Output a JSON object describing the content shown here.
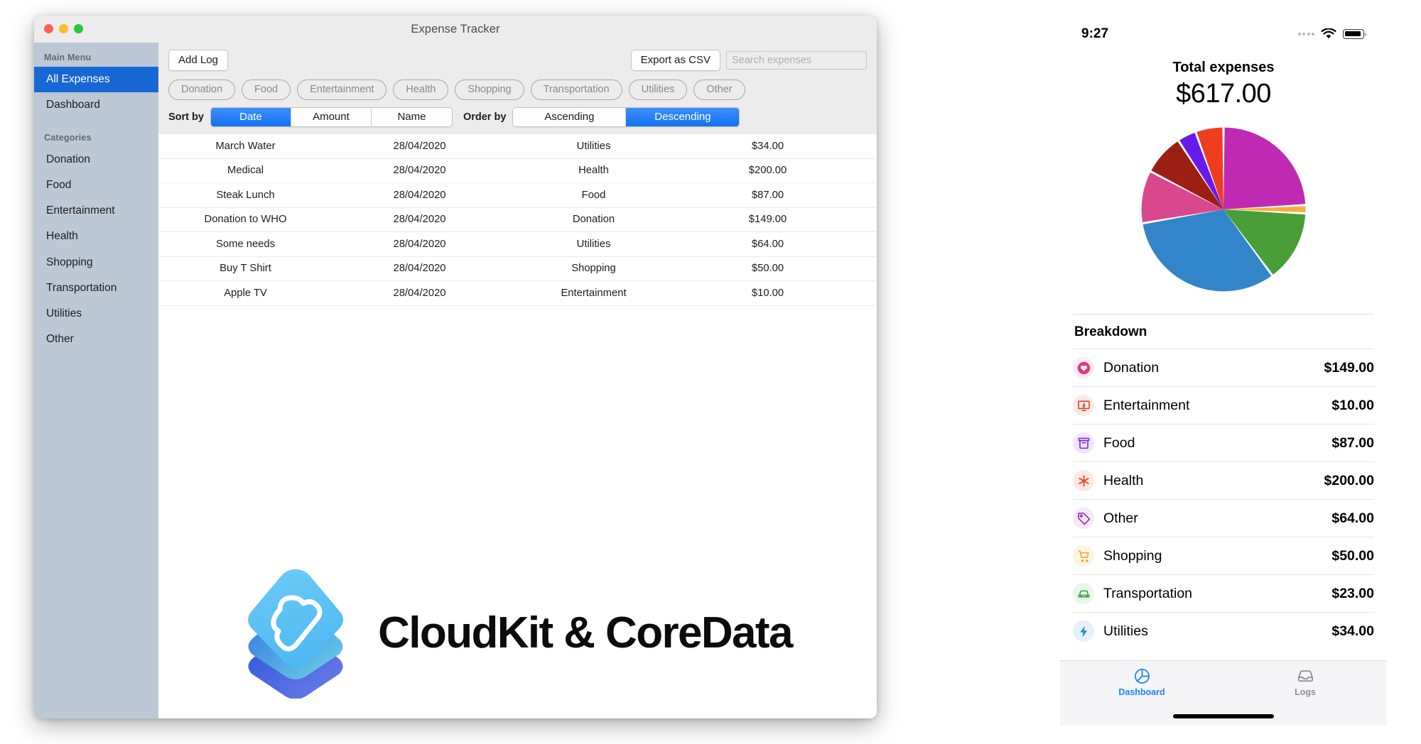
{
  "window": {
    "title": "Expense Tracker",
    "traffic_lights": [
      "close",
      "minimize",
      "zoom"
    ]
  },
  "sidebar": {
    "main_menu_header": "Main Menu",
    "main_items": [
      {
        "label": "All Expenses",
        "selected": true
      },
      {
        "label": "Dashboard",
        "selected": false
      }
    ],
    "categories_header": "Categories",
    "categories": [
      {
        "label": "Donation"
      },
      {
        "label": "Food"
      },
      {
        "label": "Entertainment"
      },
      {
        "label": "Health"
      },
      {
        "label": "Shopping"
      },
      {
        "label": "Transportation"
      },
      {
        "label": "Utilities"
      },
      {
        "label": "Other"
      }
    ]
  },
  "toolbar": {
    "add_log_label": "Add Log",
    "export_label": "Export as CSV",
    "search_placeholder": "Search expenses",
    "search_value": ""
  },
  "filter_chips": [
    "Donation",
    "Food",
    "Entertainment",
    "Health",
    "Shopping",
    "Transportation",
    "Utilities",
    "Other"
  ],
  "sort": {
    "sort_by_label": "Sort by",
    "sort_options": [
      {
        "label": "Date",
        "active": true
      },
      {
        "label": "Amount",
        "active": false
      },
      {
        "label": "Name",
        "active": false
      }
    ],
    "order_by_label": "Order by",
    "order_options": [
      {
        "label": "Ascending",
        "active": false
      },
      {
        "label": "Descending",
        "active": true
      }
    ]
  },
  "table": {
    "rows": [
      {
        "name": "March Water",
        "date": "28/04/2020",
        "category": "Utilities",
        "amount": "$34.00"
      },
      {
        "name": "Medical",
        "date": "28/04/2020",
        "category": "Health",
        "amount": "$200.00"
      },
      {
        "name": "Steak Lunch",
        "date": "28/04/2020",
        "category": "Food",
        "amount": "$87.00"
      },
      {
        "name": "Donation to WHO",
        "date": "28/04/2020",
        "category": "Donation",
        "amount": "$149.00"
      },
      {
        "name": "Some needs",
        "date": "28/04/2020",
        "category": "Utilities",
        "amount": "$64.00"
      },
      {
        "name": "Buy T Shirt",
        "date": "28/04/2020",
        "category": "Shopping",
        "amount": "$50.00"
      },
      {
        "name": "Apple TV",
        "date": "28/04/2020",
        "category": "Entertainment",
        "amount": "$10.00"
      }
    ]
  },
  "banner": {
    "title": "CloudKit & CoreData",
    "logo_icon": "cloudkit-logo"
  },
  "phone": {
    "status": {
      "time": "9:27",
      "wifi_icon": "wifi-icon",
      "battery_icon": "battery-icon"
    },
    "total_label": "Total expenses",
    "total_amount": "$617.00",
    "breakdown_title": "Breakdown",
    "breakdown": [
      {
        "label": "Donation",
        "amount": "$149.00",
        "icon": "heart-icon",
        "color": "#e4357f",
        "bg": "#fdeaf2"
      },
      {
        "label": "Entertainment",
        "amount": "$10.00",
        "icon": "tv-icon",
        "color": "#d8452b",
        "bg": "#fbe9e6"
      },
      {
        "label": "Food",
        "amount": "$87.00",
        "icon": "basket-icon",
        "color": "#7b20f0",
        "bg": "#f0e7fd"
      },
      {
        "label": "Health",
        "amount": "$200.00",
        "icon": "medical-icon",
        "color": "#f04a25",
        "bg": "#fdeae4"
      },
      {
        "label": "Other",
        "amount": "$64.00",
        "icon": "tag-icon",
        "color": "#8e2aa8",
        "bg": "#f6e9fb"
      },
      {
        "label": "Shopping",
        "amount": "$50.00",
        "icon": "cart-icon",
        "color": "#f0a82a",
        "bg": "#fdf5e4"
      },
      {
        "label": "Transportation",
        "amount": "$23.00",
        "icon": "car-icon",
        "color": "#3aa53a",
        "bg": "#e9f7ea"
      },
      {
        "label": "Utilities",
        "amount": "$34.00",
        "icon": "bolt-icon",
        "color": "#2b86e0",
        "bg": "#e7f1fc"
      }
    ],
    "tabs": [
      {
        "label": "Dashboard",
        "icon": "pie-chart-icon",
        "active": true
      },
      {
        "label": "Logs",
        "icon": "tray-icon",
        "active": false
      }
    ]
  },
  "chart_data": {
    "type": "pie",
    "title": "Total expenses",
    "labels": [
      "Donation",
      "Entertainment",
      "Food",
      "Health",
      "Other",
      "Shopping",
      "Transportation",
      "Utilities"
    ],
    "values": [
      149,
      10,
      87,
      200,
      64,
      50,
      23,
      34
    ],
    "total": 617,
    "colors": [
      "#c02ab2",
      "#efb03c",
      "#4a9e37",
      "#3185c8",
      "#d9488f",
      "#9c1f13",
      "#6a1ae8",
      "#ef3d1f"
    ],
    "legend": "none",
    "units": "USD"
  }
}
